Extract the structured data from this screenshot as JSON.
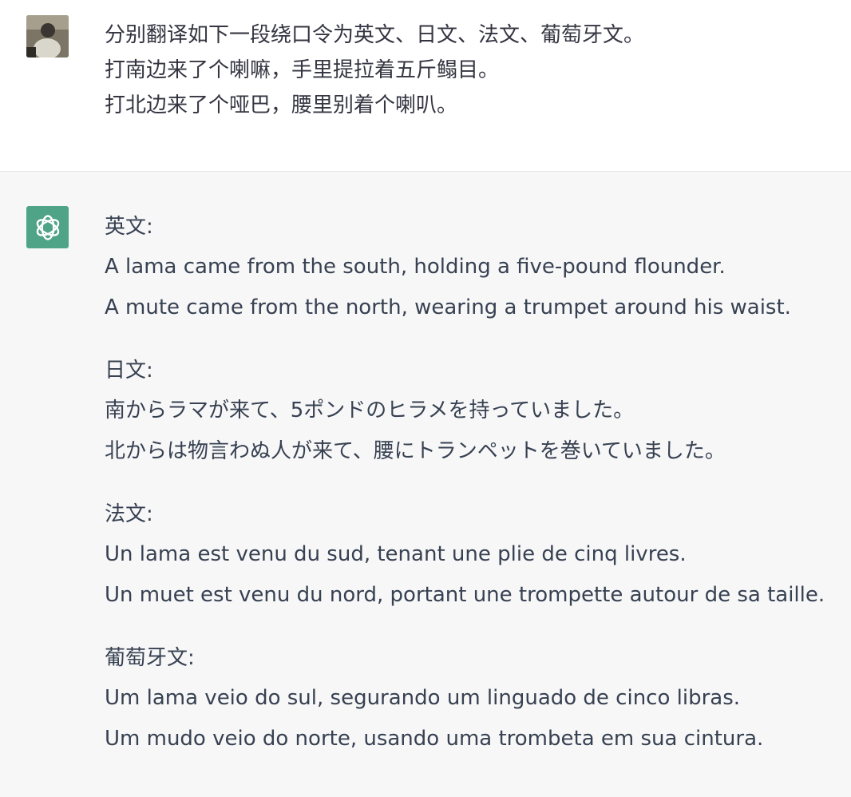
{
  "conversation": {
    "user_message": {
      "lines": [
        "分别翻译如下一段绕口令为英文、日文、法文、葡萄牙文。",
        "打南边来了个喇嘛，手里提拉着五斤鳎目。",
        "打北边来了个哑巴，腰里别着个喇叭。"
      ]
    },
    "assistant_message": {
      "sections": [
        {
          "title": "英文:",
          "lines": [
            "A lama came from the south, holding a five-pound flounder.",
            "A mute came from the north, wearing a trumpet around his waist."
          ]
        },
        {
          "title": "日文:",
          "lines": [
            "南からラマが来て、5ポンドのヒラメを持っていました。",
            "北からは物言わぬ人が来て、腰にトランペットを巻いていました。"
          ]
        },
        {
          "title": "法文:",
          "lines": [
            "Un lama est venu du sud, tenant une plie de cinq livres.",
            "Un muet est venu du nord, portant une trompette autour de sa taille."
          ]
        },
        {
          "title": "葡萄牙文:",
          "lines": [
            "Um lama veio do sul, segurando um linguado de cinco libras.",
            "Um mudo veio do norte, usando uma trombeta em sua cintura."
          ]
        }
      ]
    }
  },
  "icons": {
    "user_avatar": "user-photo-avatar",
    "assistant_avatar": "openai-logo-icon"
  },
  "colors": {
    "assistant_avatar_bg": "#4fa386",
    "assistant_turn_bg": "#f7f7f8",
    "text": "#374151"
  }
}
